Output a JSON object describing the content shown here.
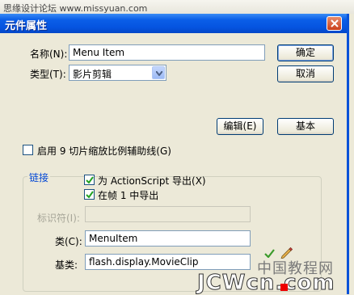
{
  "watermark_top": "思缘设计论坛 www.missyuan.com",
  "dialog": {
    "title": "元件属性"
  },
  "name_field": {
    "label": "名称(N):",
    "value": "Menu Item"
  },
  "type_field": {
    "label": "类型(T):",
    "value": "影片剪辑"
  },
  "buttons": {
    "ok": "确定",
    "cancel": "取消",
    "edit": "编辑(E)",
    "basic": "基本"
  },
  "guides_checkbox": {
    "label": "启用 9 切片缩放比例辅助线(G)",
    "checked": false
  },
  "linkage": {
    "group_label": "链接",
    "export_actionscript": {
      "label": "为 ActionScript 导出(X)",
      "checked": true
    },
    "export_first_frame": {
      "label": "在帧 1 中导出",
      "checked": true
    },
    "identifier": {
      "label": "标识符(I):",
      "value": ""
    },
    "class": {
      "label": "类(C):",
      "value": "MenuItem"
    },
    "base_class": {
      "label": "基类:",
      "value": "flash.display.MovieClip"
    }
  },
  "watermark_bottom": {
    "cn": "中国教程网",
    "en": "JCWcn.com"
  },
  "colors": {
    "titlebar": "#0554E0",
    "dialog_bg": "#ECE9D8",
    "group_label": "#0046D5"
  }
}
